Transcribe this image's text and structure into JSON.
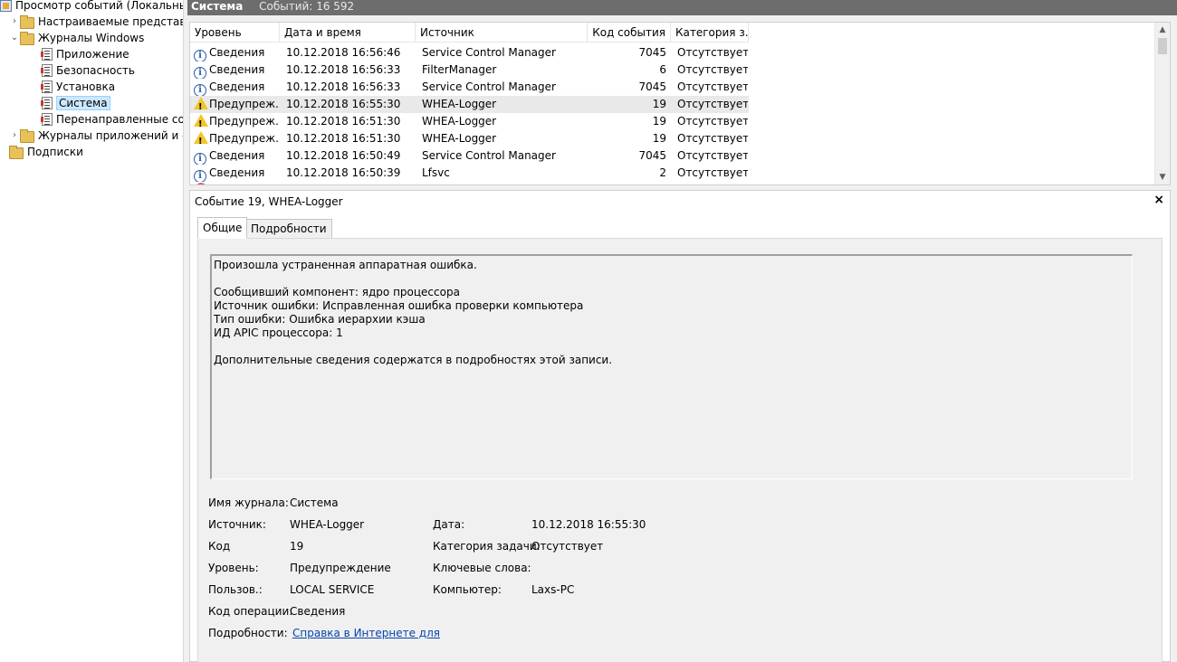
{
  "tree": {
    "items": [
      {
        "label": "Просмотр событий (Локальный)",
        "chev": "",
        "icon": "app"
      },
      {
        "label": "Настраиваемые представления",
        "chev": "›",
        "icon": "folder"
      },
      {
        "label": "Журналы Windows",
        "chev": "⌄",
        "icon": "folder"
      },
      {
        "label": "Приложение",
        "chev": "",
        "icon": "log"
      },
      {
        "label": "Безопасность",
        "chev": "",
        "icon": "log"
      },
      {
        "label": "Установка",
        "chev": "",
        "icon": "log"
      },
      {
        "label": "Система",
        "chev": "",
        "icon": "log"
      },
      {
        "label": "Перенаправленные события",
        "chev": "",
        "icon": "log"
      },
      {
        "label": "Журналы приложений и служб",
        "chev": "›",
        "icon": "folder"
      },
      {
        "label": "Подписки",
        "chev": "",
        "icon": "folder"
      }
    ]
  },
  "header": {
    "title": "Система",
    "count": "Событий: 16 592"
  },
  "list": {
    "columns": [
      "Уровень",
      "Дата и время",
      "Источник",
      "Код события",
      "Категория з..."
    ],
    "rows": [
      {
        "level": "Сведения",
        "type": "info",
        "date": "10.12.2018 16:56:46",
        "source": "Service Control Manager",
        "code": "7045",
        "category": "Отсутствует"
      },
      {
        "level": "Сведения",
        "type": "info",
        "date": "10.12.2018 16:56:33",
        "source": "FilterManager",
        "code": "6",
        "category": "Отсутствует"
      },
      {
        "level": "Сведения",
        "type": "info",
        "date": "10.12.2018 16:56:33",
        "source": "Service Control Manager",
        "code": "7045",
        "category": "Отсутствует"
      },
      {
        "level": "Предупреж...",
        "type": "warn",
        "date": "10.12.2018 16:55:30",
        "source": "WHEA-Logger",
        "code": "19",
        "category": "Отсутствует"
      },
      {
        "level": "Предупреж...",
        "type": "warn",
        "date": "10.12.2018 16:51:30",
        "source": "WHEA-Logger",
        "code": "19",
        "category": "Отсутствует"
      },
      {
        "level": "Предупреж...",
        "type": "warn",
        "date": "10.12.2018 16:51:30",
        "source": "WHEA-Logger",
        "code": "19",
        "category": "Отсутствует"
      },
      {
        "level": "Сведения",
        "type": "info",
        "date": "10.12.2018 16:50:49",
        "source": "Service Control Manager",
        "code": "7045",
        "category": "Отсутствует"
      },
      {
        "level": "Сведения",
        "type": "info",
        "date": "10.12.2018 16:50:39",
        "source": "Lfsvc",
        "code": "2",
        "category": "Отсутствует"
      }
    ]
  },
  "detail": {
    "title": "Событие 19, WHEA-Logger",
    "close": "×",
    "tabs": [
      "Общие",
      "Подробности"
    ],
    "description": [
      "Произошла устраненная аппаратная ошибка.",
      "",
      "Сообщивший компонент: ядро процессора",
      "Источник ошибки: Исправленная ошибка проверки компьютера",
      "Тип ошибки: Ошибка иерархии кэша",
      "ИД APIC процессора: 1",
      "",
      "Дополнительные сведения содержатся в подробностях этой записи."
    ],
    "props": {
      "log_name_label": "Имя журнала:",
      "log_name": "Система",
      "source_label": "Источник:",
      "source": "WHEA-Logger",
      "date_label": "Дата:",
      "date": "10.12.2018 16:55:30",
      "code_label": "Код",
      "code": "19",
      "task_label": "Категория задачи:",
      "task": "Отсутствует",
      "level_label": "Уровень:",
      "level": "Предупреждение",
      "keywords_label": "Ключевые слова:",
      "user_label": "Пользов.:",
      "user": "LOCAL SERVICE",
      "computer_label": "Компьютер:",
      "computer": "Laxs-PC",
      "opcode_label": "Код операции:",
      "opcode": "Сведения",
      "more_label": "Подробности:",
      "more_link": "Справка в Интернете для"
    }
  }
}
